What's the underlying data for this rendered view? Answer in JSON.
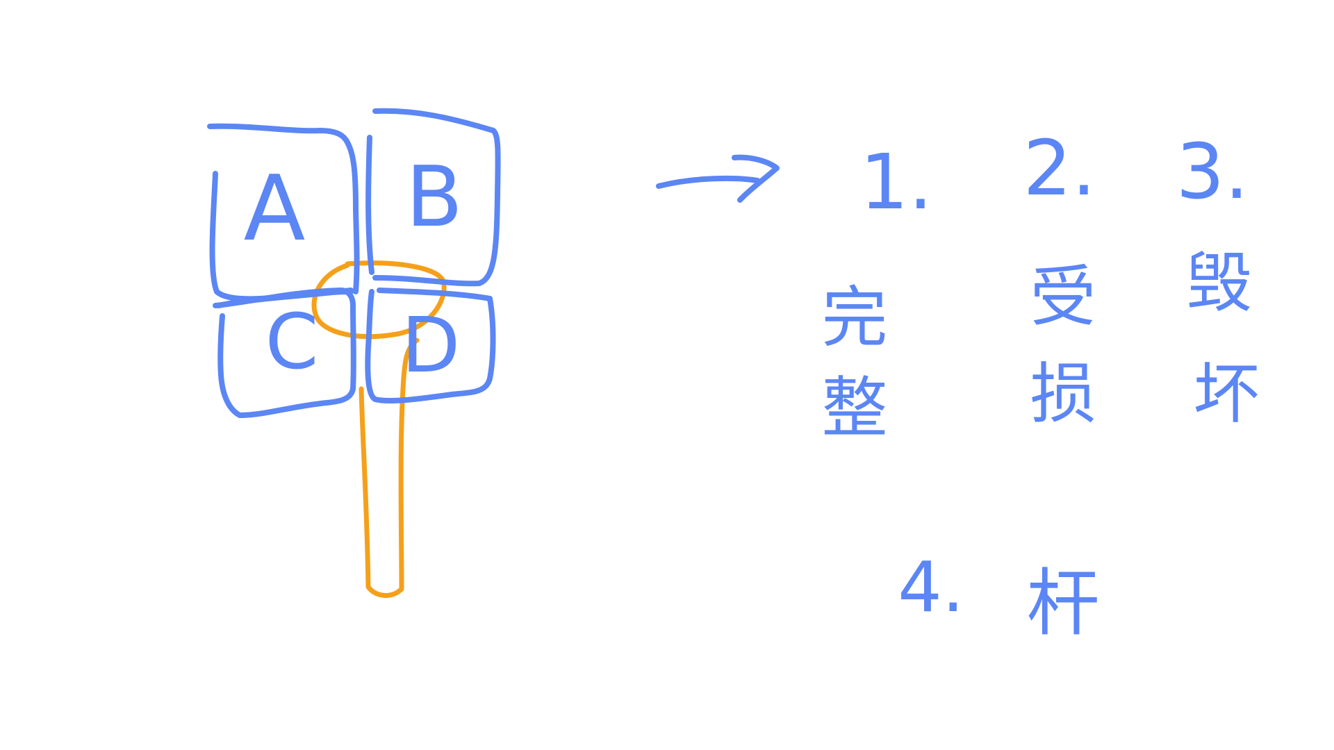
{
  "colors": {
    "ink_blue": "#5b86f4",
    "ink_orange": "#f5a01a",
    "background": "#ffffff"
  },
  "sign": {
    "panels": [
      {
        "label": "A"
      },
      {
        "label": "B"
      },
      {
        "label": "C"
      },
      {
        "label": "D"
      }
    ]
  },
  "states": [
    {
      "number": "1.",
      "label_chars": [
        "完",
        "整"
      ]
    },
    {
      "number": "2.",
      "label_chars": [
        "受",
        "损"
      ]
    },
    {
      "number": "3.",
      "label_chars": [
        "毁",
        "坏"
      ]
    },
    {
      "number": "4.",
      "label_chars": [
        "杆"
      ]
    }
  ],
  "arrow": {
    "icon": "right-arrow-icon"
  }
}
